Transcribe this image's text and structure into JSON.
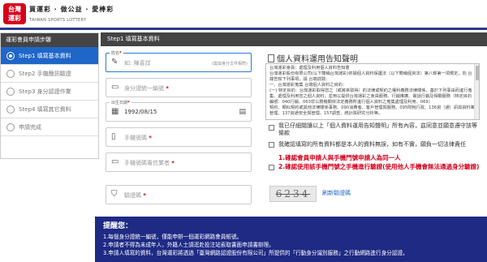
{
  "header": {
    "logo_top": "台灣",
    "logo_bottom": "運彩",
    "slogan": "買運彩 · 做公益 · 愛棒彩",
    "subtitle_en": "TAIWAN SPORTS LOTTERY"
  },
  "sidebar": {
    "title": "運彩會員申請步驟",
    "items": [
      {
        "label": "Step1 填寫基本資料",
        "active": true
      },
      {
        "label": "Step2 手機簡訊驗證"
      },
      {
        "label": "Step3 身分認證作業"
      },
      {
        "label": "Step4 填寫其它資料"
      },
      {
        "label": "申請完成"
      }
    ]
  },
  "main": {
    "title": "Step1 填寫基本資料"
  },
  "form": {
    "name": {
      "label": "姓名",
      "placeholder": "如: 陳喜詳",
      "hint": "(需與身分文件相符)",
      "icon": "pencil-icon"
    },
    "id_number": {
      "placeholder": "身分證統一編號",
      "icon": "id-card-icon"
    },
    "birthday": {
      "label": "出生日期",
      "value": "1992/08/15",
      "icon": "calendar-icon"
    },
    "mobile": {
      "placeholder": "手機號碼",
      "icon": "phone-icon"
    },
    "mobile_serial": {
      "placeholder": "手機號碼電信業者",
      "icon": "sim-icon"
    },
    "captcha": {
      "placeholder": "驗證碼",
      "image_text": "6234",
      "refresh_label": "刷新驗證碼",
      "icon": "shield-icon"
    },
    "required_mark": "*"
  },
  "notice": {
    "title": "個人資料運用告知聲明",
    "lines": [
      "台灣運彩會員：處理及利用個人資料告知書",
      "台灣運彩股份有限公司(以下簡稱台灣運彩)依據個人資料保護法（以下簡稱個資法）第八條第一項規定，向 台端告知下列事項，請 台端詳閱：",
      "一、台灣運彩蒐集 台端個人資料之目的：",
      "(一) 特定目的：台灣運彩取得您之（或將來取得）的法律或契約之權利義務法律關係，基於下列事由而進行蒐集、處理及利用您之個人資料；並用以提供台灣運彩之會員服務、行銷推廣、電話行銷及相關服務（特定目的編號：040行銷、063非公務機關依法定義務所進行個人資料之蒐集處理及利用、069）",
      "契約、類似契約或其他法律關係事務、090消費者、客戶管理與服務、095財稅行政、136資（通）訊與資料庫管理、137資通安全與管理、157調查、統計與研究分析等。"
    ]
  },
  "agreements": {
    "read_notice": "我已仔細閱讀以上「個人資料運用告知聲明」所有內容，茲同意並願意遵守該等條款",
    "confirm_true": "我確認填寫的所有資料都是本人的資料無誤，如有不實，願負一切法律責任",
    "warn_line1": "1.確認會員申請人與手機門號申請人為同一人",
    "warn_line2": "2.確認使用該手機門號之手機進行驗證(使用他人手機會無法通過身分驗證)"
  },
  "reminder": {
    "title": "提醒您：",
    "lines": [
      "1.每個身分證統一編號，僅能申辦一個運彩網路會員帳號。",
      "2.申請者不得為未成年人，外籍人士請逕赴投注站索取書面申請書辦理。",
      "3.申請人填寫的資料，台灣運彩將透過「臺灣網路認證股份有限公司」所提供的「行動身分識別服務」之行動網路進行身分認證。"
    ]
  },
  "colors": {
    "brand_red": "#d6001c",
    "accent_blue": "#1f66c9",
    "reminder_bg": "#1e2a84",
    "title_bar": "#444444"
  }
}
